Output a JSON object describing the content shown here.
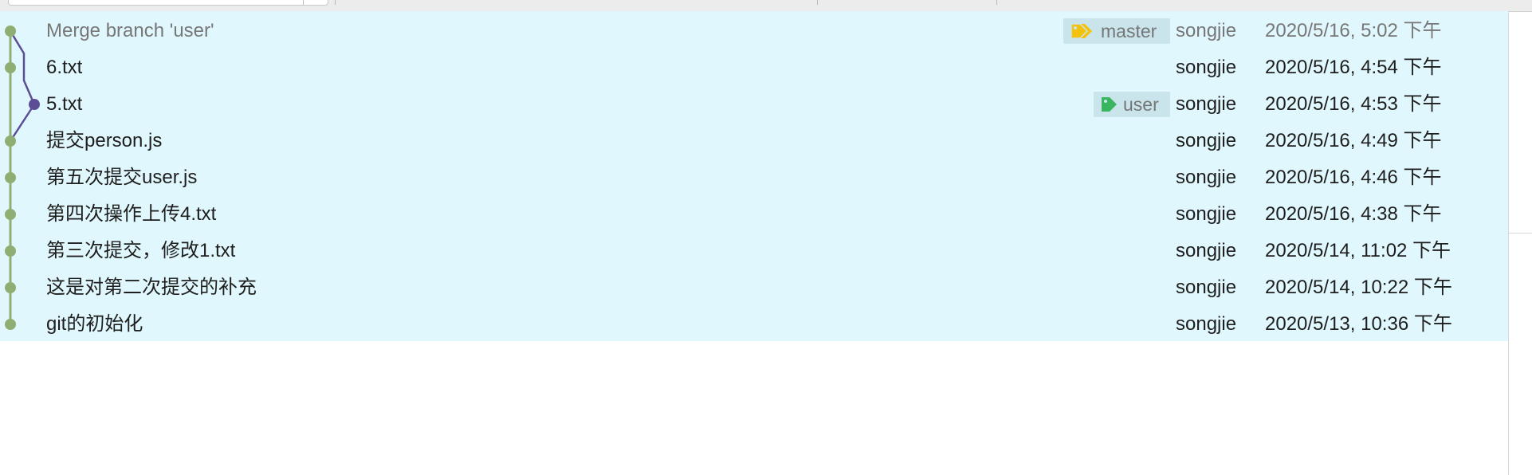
{
  "colors": {
    "row_background": "#e0f8fd",
    "main_branch_line": "#8fae73",
    "side_branch_line": "#5b4e96",
    "ref_badge_background": "#c9e4ea",
    "master_tag_color": "#f4c20d",
    "user_tag_color": "#39b55f"
  },
  "commits": [
    {
      "message": "Merge branch 'user'",
      "is_merge": true,
      "ref": "master",
      "ref_icon": "tags-icon",
      "author": "songjie",
      "date": "2020/5/16, 5:02 下午",
      "lane": 0
    },
    {
      "message": "6.txt",
      "is_merge": false,
      "ref": "",
      "author": "songjie",
      "date": "2020/5/16, 4:54 下午",
      "lane": 0
    },
    {
      "message": "5.txt",
      "is_merge": false,
      "ref": "user",
      "ref_icon": "tag-icon",
      "author": "songjie",
      "date": "2020/5/16, 4:53 下午",
      "lane": 1
    },
    {
      "message": "提交person.js",
      "is_merge": false,
      "ref": "",
      "author": "songjie",
      "date": "2020/5/16, 4:49 下午",
      "lane": 0
    },
    {
      "message": "第五次提交user.js",
      "is_merge": false,
      "ref": "",
      "author": "songjie",
      "date": "2020/5/16, 4:46 下午",
      "lane": 0
    },
    {
      "message": "第四次操作上传4.txt",
      "is_merge": false,
      "ref": "",
      "author": "songjie",
      "date": "2020/5/16, 4:38 下午",
      "lane": 0
    },
    {
      "message": "第三次提交，修改1.txt",
      "is_merge": false,
      "ref": "",
      "author": "songjie",
      "date": "2020/5/14, 11:02 下午",
      "lane": 0
    },
    {
      "message": "这是对第二次提交的补充",
      "is_merge": false,
      "ref": "",
      "author": "songjie",
      "date": "2020/5/14, 10:22 下午",
      "lane": 0
    },
    {
      "message": "git的初始化",
      "is_merge": false,
      "ref": "",
      "author": "songjie",
      "date": "2020/5/13, 10:36 下午",
      "lane": 0
    }
  ]
}
